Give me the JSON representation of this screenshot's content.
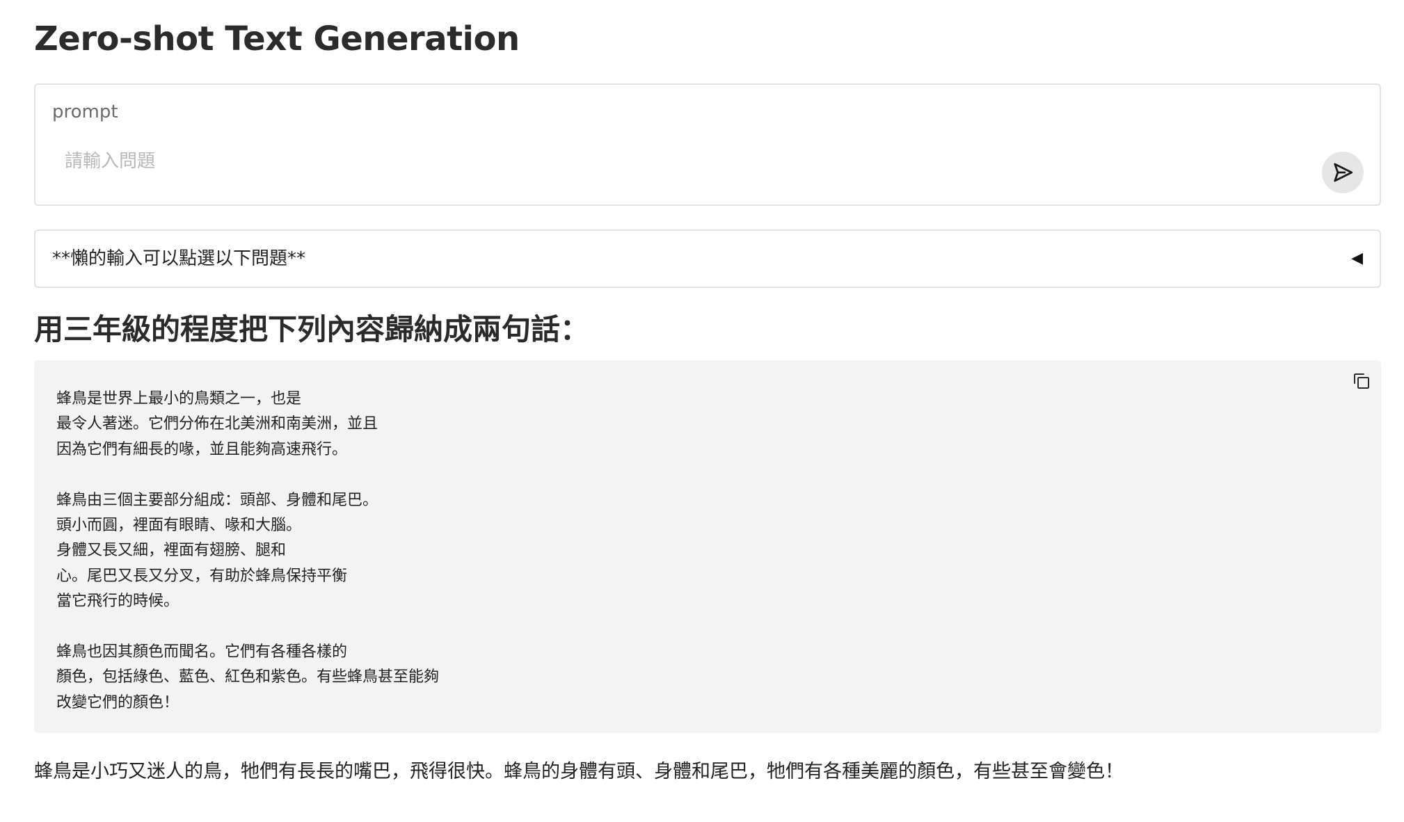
{
  "app": {
    "title": "Zero-shot Text Generation"
  },
  "prompt": {
    "label": "prompt",
    "placeholder": "請輸入問題",
    "value": "",
    "send_icon": "send-icon"
  },
  "accordion": {
    "label": "**懶的輸入可以點選以下問題**",
    "state": "collapsed",
    "arrow_icon": "triangle-left-icon"
  },
  "example": {
    "heading": "用三年級的程度把下列內容歸納成兩句話：",
    "body": "蜂鳥是世界上最小的鳥類之一，也是\n最令人著迷。它們分佈在北美洲和南美洲，並且\n因為它們有細長的喙，並且能夠高速飛行。\n\n蜂鳥由三個主要部分組成：頭部、身體和尾巴。\n頭小而圓，裡面有眼睛、喙和大腦。\n身體又長又細，裡面有翅膀、腿和\n心。尾巴又長又分叉，有助於蜂鳥保持平衡\n當它飛行的時候。\n\n蜂鳥也因其顏色而聞名。它們有各種各樣的\n顏色，包括綠色、藍色、紅色和紫色。有些蜂鳥甚至能夠\n改變它們的顏色！",
    "copy_icon": "copy-icon"
  },
  "result": {
    "text": "蜂鳥是小巧又迷人的鳥，牠們有長長的嘴巴，飛得很快。蜂鳥的身體有頭、身體和尾巴，牠們有各種美麗的顏色，有些甚至會變色！"
  }
}
